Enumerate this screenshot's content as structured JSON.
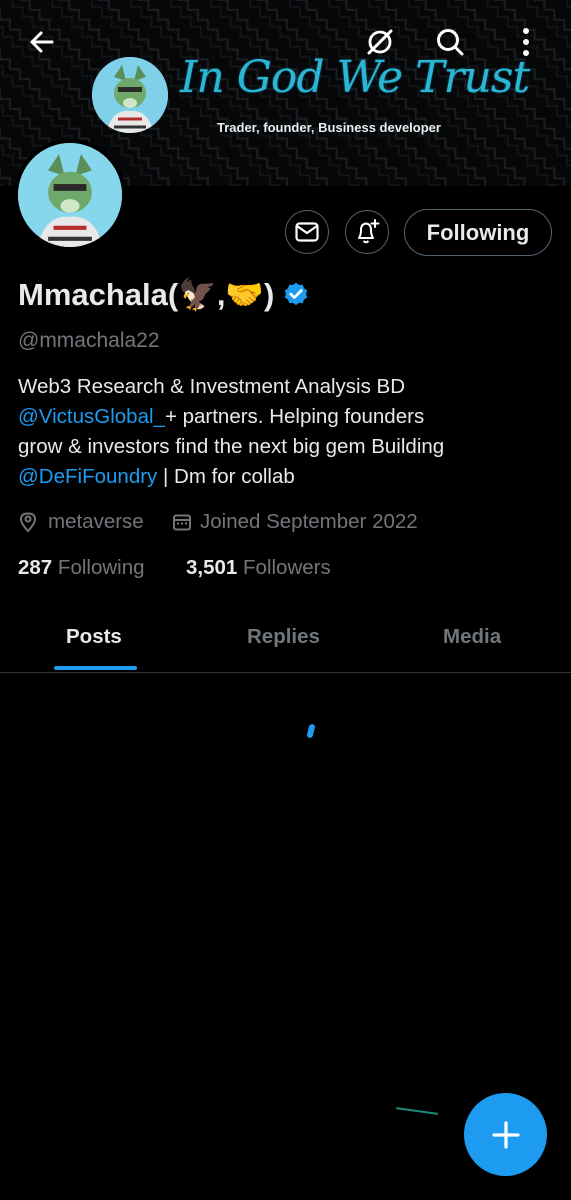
{
  "banner": {
    "title": "In God We Trust",
    "subtitle": "Trader, founder, Business developer"
  },
  "topbar": {
    "back_icon": "arrow-left-icon",
    "grok_icon": "grok-icon",
    "search_icon": "search-icon",
    "more_icon": "more-vertical-icon"
  },
  "actions": {
    "message_icon": "mail-icon",
    "notify_icon": "bell-plus-icon",
    "follow_label": "Following"
  },
  "profile": {
    "name": "Mmachala(🦅,🤝)",
    "handle": "@mmachala22",
    "verified": true,
    "bio_line1": "Web3 Research & Investment Analysis  BD",
    "bio_mention1": "@VictusGlobal_",
    "bio_line2": "+ partners. Helping founders",
    "bio_line3": "grow & investors find the next big gem Building",
    "bio_mention2": "@DeFiFoundry",
    "bio_line4": " | Dm for collab",
    "location": "metaverse",
    "joined": "Joined September 2022",
    "following_count": "287",
    "following_label": "Following",
    "followers_count": "3,501",
    "followers_label": "Followers"
  },
  "tabs": [
    {
      "label": "Posts",
      "active": true
    },
    {
      "label": "Replies",
      "active": false
    },
    {
      "label": "Media",
      "active": false
    }
  ],
  "fab": {
    "icon": "plus-icon"
  },
  "colors": {
    "accent": "#1d9bf0",
    "background": "#000000",
    "muted": "#71767b",
    "banner_text": "#2bb6d6"
  }
}
